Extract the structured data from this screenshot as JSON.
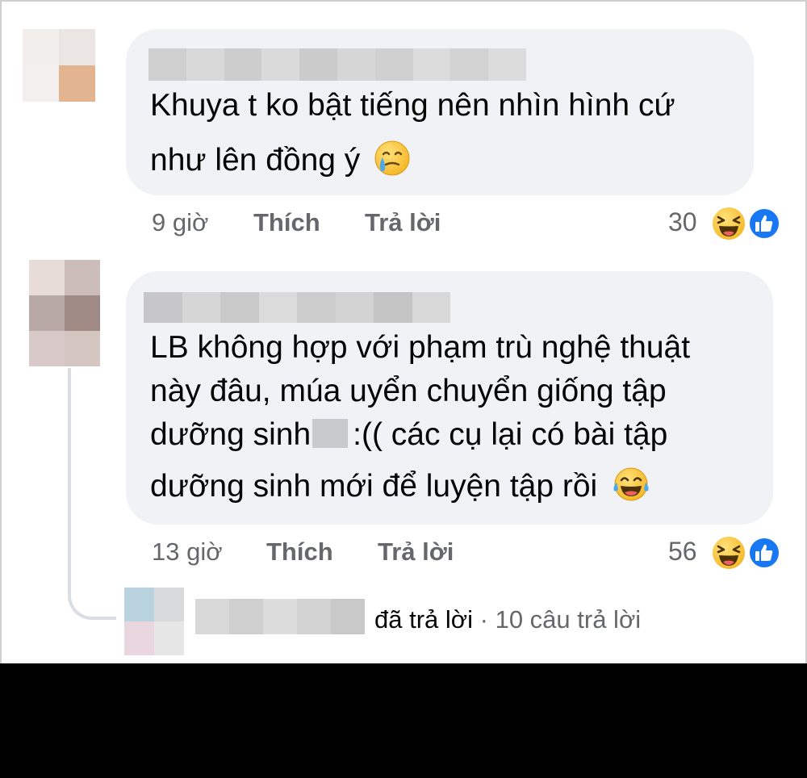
{
  "comments": [
    {
      "lines": [
        "Khuya t ko bật tiếng nên nhìn hình cứ",
        "như lên đồng ý"
      ],
      "inline_emoji": "crying-smile-emoji",
      "time": "9 giờ",
      "like_label": "Thích",
      "reply_label": "Trả lời",
      "reaction_count": "30",
      "reactions": [
        "haha",
        "like"
      ]
    },
    {
      "lines": [
        "LB không hợp với phạm trù nghệ thuật",
        "này đâu, múa uyển chuyển giống tập",
        "dưỡng sinh",
        ":(( các cụ lại có bài tập",
        "dưỡng sinh mới để luyện tập rồi"
      ],
      "inline_emoji": "tears-of-joy-emoji",
      "time": "13 giờ",
      "like_label": "Thích",
      "reply_label": "Trả lời",
      "reaction_count": "56",
      "reactions": [
        "haha",
        "like"
      ]
    }
  ],
  "reply_summary": {
    "action": "đã trả lời",
    "separator": "·",
    "count_text": "10 câu trả lời"
  },
  "colors": {
    "bubble": "#f0f2f5",
    "meta_text": "#65676b",
    "like_blue": "#1877f2",
    "haha_yellow": "#f7b928"
  }
}
